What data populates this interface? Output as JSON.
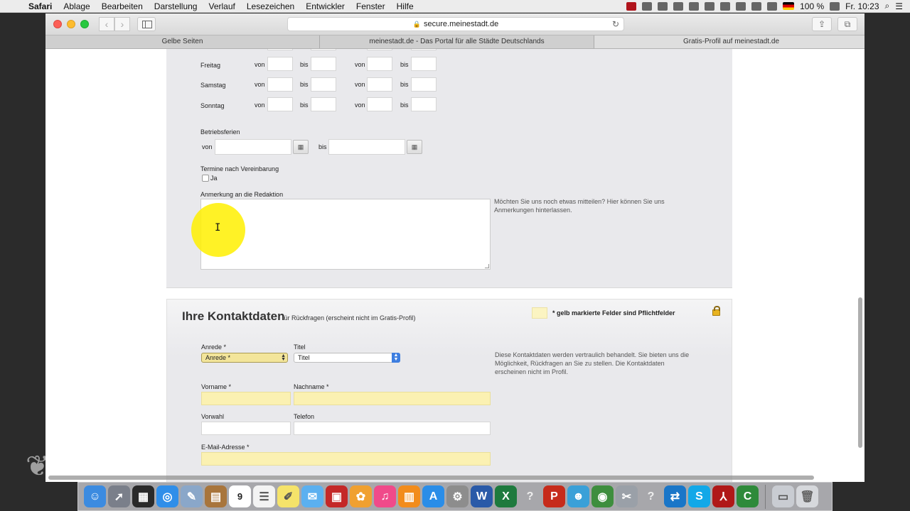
{
  "menubar": {
    "apple_icon": "apple-logo-icon",
    "items": [
      "Safari",
      "Ablage",
      "Bearbeiten",
      "Darstellung",
      "Verlauf",
      "Lesezeichen",
      "Entwickler",
      "Fenster",
      "Hilfe"
    ],
    "battery": "100 %",
    "clock": "Fr. 10:23"
  },
  "browser": {
    "url": "secure.meinestadt.de",
    "tabs": [
      "Gelbe Seiten",
      "meinestadt.de - Das Portal für alle Städte Deutschlands",
      "Gratis-Profil auf meinestadt.de"
    ],
    "new_tab_symbol": "+"
  },
  "hours": {
    "days": [
      "Freitag",
      "Samstag",
      "Sonntag"
    ],
    "from_label": "von",
    "to_label": "bis"
  },
  "holidays": {
    "label": "Betriebsferien",
    "from_label": "von",
    "to_label": "bis"
  },
  "appointment": {
    "label": "Termine nach Vereinbarung",
    "checkbox_label": "Ja",
    "checked": false
  },
  "remark": {
    "label": "Anmerkung an die Redaktion",
    "value": "",
    "hint": "Möchten Sie uns noch etwas mitteilen? Hier können Sie uns Anmerkungen hinterlassen."
  },
  "contact": {
    "title": "Ihre Kontaktdaten",
    "subtitle": "für Rückfragen (erscheint nicht im Gratis-Profil)",
    "legend": "* gelb markierte Felder sind Pflichtfelder",
    "salutation_label": "Anrede *",
    "salutation_value": "Anrede *",
    "title_label": "Titel",
    "title_value": "Titel",
    "firstname_label": "Vorname *",
    "lastname_label": "Nachname *",
    "areacode_label": "Vorwahl",
    "phone_label": "Telefon",
    "email_label": "E-Mail-Adresse *",
    "hint": "Diese Kontaktdaten werden vertraulich behandelt. Sie bieten uns die Möglichkeit, Rückfragen an Sie zu stellen. Die Kontaktdaten erscheinen nicht im Profil."
  },
  "colors": {
    "required_field": "#fbf1b2",
    "panel_bg": "#e9e9ec",
    "cursor_highlight": "#fff000"
  }
}
